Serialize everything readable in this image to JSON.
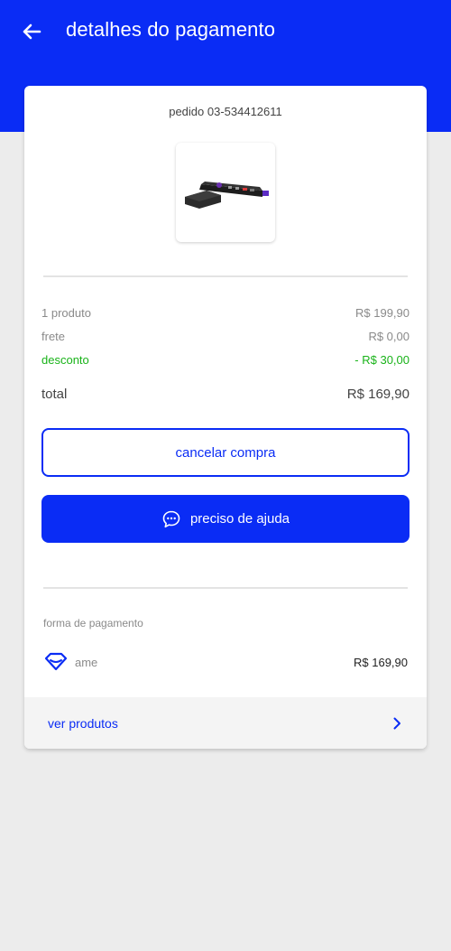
{
  "header": {
    "back_icon": "arrow-left-icon",
    "title": "detalhes do pagamento"
  },
  "order": {
    "id_label": "pedido 03-534412611",
    "product_image": "streaming-device-with-remote"
  },
  "summary": {
    "products_label": "1 produto",
    "products_value": "R$ 199,90",
    "shipping_label": "frete",
    "shipping_value": "R$ 0,00",
    "discount_label": "desconto",
    "discount_value": "- R$ 30,00",
    "total_label": "total",
    "total_value": "R$ 169,90"
  },
  "actions": {
    "cancel_label": "cancelar compra",
    "help_label": "preciso de ajuda",
    "help_icon": "chat-bubble-icon"
  },
  "payment": {
    "section_label": "forma de pagamento",
    "method_icon": "ame-heart-icon",
    "method_label": "ame",
    "method_amount": "R$ 169,90"
  },
  "footer": {
    "label": "ver produtos",
    "icon": "chevron-right-icon"
  },
  "colors": {
    "brand": "#0a2cf5",
    "discount": "#19b319",
    "background": "#ececec"
  }
}
